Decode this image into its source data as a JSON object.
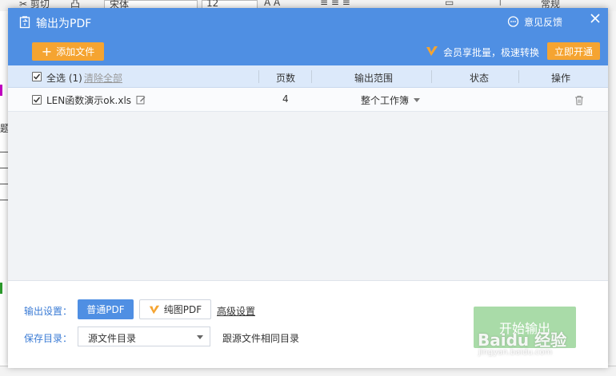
{
  "background": {
    "toolbar_items": [
      "剪切",
      "宋体",
      "12",
      "常规"
    ],
    "sheet_char": "题"
  },
  "dialog": {
    "title": "输出为PDF",
    "feedback_label": "意见反馈",
    "add_file_label": "添加文件",
    "vip_text": "会员享批量，极速转换",
    "vip_button_label": "立即开通"
  },
  "table": {
    "select_all_label": "全选",
    "selected_count": "(1)",
    "clear_all_label": "清除全部",
    "columns": {
      "pages": "页数",
      "range": "输出范围",
      "status": "状态",
      "action": "操作"
    },
    "rows": [
      {
        "file_name": "LEN函数演示ok.xls",
        "pages": "4",
        "range": "整个工作簿",
        "status": ""
      }
    ]
  },
  "footer": {
    "output_settings_label": "输出设置：",
    "normal_pdf_label": "普通PDF",
    "image_pdf_label": "纯图PDF",
    "advanced_label": "高级设置",
    "save_dir_label": "保存目录：",
    "save_dir_value": "源文件目录",
    "save_dir_note": "跟源文件相同目录",
    "start_label": "开始输出"
  },
  "watermark": {
    "text": "Baidu 经验",
    "url": "jingyan.baidu.com"
  },
  "colors": {
    "header_blue": "#4f8fe3",
    "orange": "#f5a431",
    "start_green": "#a9dba8",
    "link_blue": "#3a7bd5"
  }
}
